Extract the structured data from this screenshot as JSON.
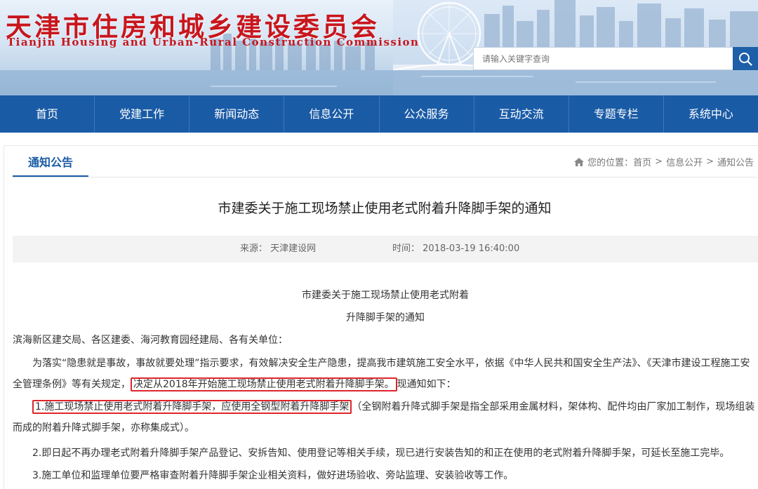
{
  "header": {
    "title_cn": "天津市住房和城乡建设委员会",
    "title_en": "Tianjin Housing and Urban-Rural Construction Commission",
    "search_placeholder": "请输入关键字查询"
  },
  "nav": {
    "items": [
      "首页",
      "党建工作",
      "新闻动态",
      "信息公开",
      "公众服务",
      "互动交流",
      "专题专栏",
      "系统中心"
    ]
  },
  "section": {
    "tab": "通知公告",
    "breadcrumb_prefix": "您的位置：",
    "breadcrumb": [
      "首页",
      "信息公开",
      "通知公告"
    ]
  },
  "article": {
    "title": "市建委关于施工现场禁止使用老式附着升降脚手架的通知",
    "source_label": "来源：",
    "source": "天津建设网",
    "time_label": "时间：",
    "time": "2018-03-19 16:40:00",
    "heading_line1": "市建委关于施工现场禁止使用老式附着",
    "heading_line2": "升降脚手架的通知",
    "recipients": "滨海新区建交局、各区建委、海河教育园经建局、各有关单位：",
    "intro_before": "为落实“隐患就是事故，事故就要处理”指示要求，有效解决安全生产隐患，提高我市建筑施工安全水平，依据《中华人民共和国安全生产法》、《天津市建设工程施工安全管理条例》等有关规定，",
    "intro_highlight": "决定从2018年开始施工现场禁止使用老式附着升降脚手架。",
    "intro_after": "现通知如下：",
    "item1_prefix": "1.",
    "item1_highlight": "施工现场禁止使用老式附着升降脚手架，应使用全钢型附着升降脚手架",
    "item1_after": "（全钢附着升降式脚手架是指全部采用金属材料，架体构、配件均由厂家加工制作，现场组装而成的附着升降式脚手架，亦称集成式）。",
    "item2": "2.即日起不再办理老式附着升降脚手架产品登记、安拆告知、使用登记等相关手续，现已进行安装告知的和正在使用的老式附着升降脚手架，可延长至施工完毕。",
    "item3": "3.施工单位和监理单位要严格审查附着升降脚手架企业相关资料，做好进场验收、旁站监理、安装验收等工作。"
  },
  "colors": {
    "brand_red": "#c8161d",
    "nav_blue": "#1a5ba6",
    "highlight_red": "#e0242a"
  }
}
